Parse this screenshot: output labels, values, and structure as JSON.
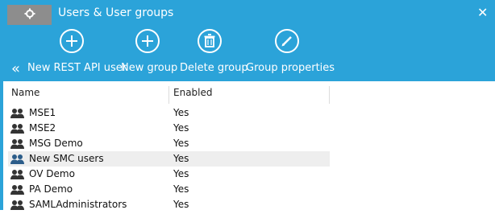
{
  "window": {
    "title": "Users & User groups",
    "gear_icon": "gear-icon",
    "close_glyph": "✕"
  },
  "toolbar": {
    "back_glyph": "«",
    "actions": [
      {
        "label": "New REST API user",
        "icon": "plus-circle-icon"
      },
      {
        "label": "New group",
        "icon": "plus-circle-icon"
      },
      {
        "label": "Delete group",
        "icon": "trash-icon"
      },
      {
        "label": "Group properties",
        "icon": "pencil-icon"
      }
    ]
  },
  "table": {
    "columns": [
      "Name",
      "Enabled"
    ],
    "rows": [
      {
        "name": "MSE1",
        "enabled": "Yes"
      },
      {
        "name": "MSE2",
        "enabled": "Yes"
      },
      {
        "name": "MSG Demo",
        "enabled": "Yes"
      },
      {
        "name": "New SMC users",
        "enabled": "Yes",
        "selected": true
      },
      {
        "name": "OV Demo",
        "enabled": "Yes"
      },
      {
        "name": "PA Demo",
        "enabled": "Yes"
      },
      {
        "name": "SAMLAdministrators",
        "enabled": "Yes"
      }
    ]
  },
  "colors": {
    "accent": "#2ba3d9",
    "gear_tab": "#8d8d8d",
    "selected_row": "#eeeeee",
    "group_icon_selected": "#2c5d8a",
    "group_icon": "#333333"
  }
}
